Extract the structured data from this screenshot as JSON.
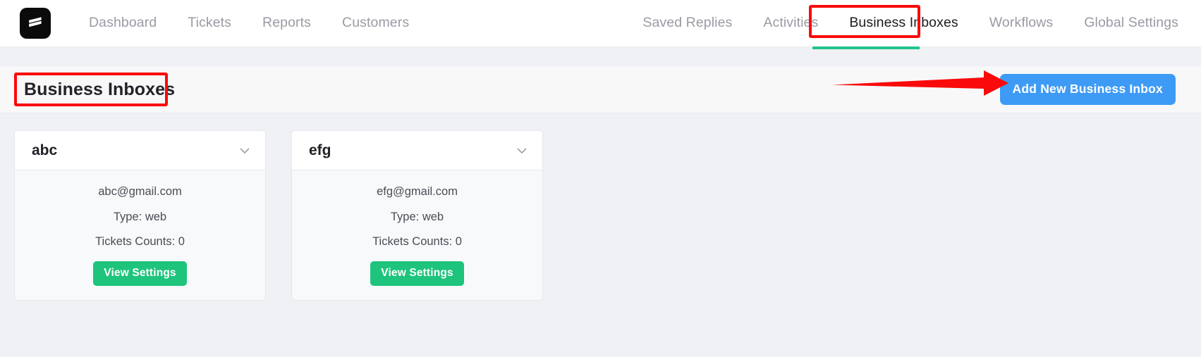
{
  "navbar": {
    "logo_icon": "brand-logo-icon",
    "left_items": [
      {
        "label": "Dashboard",
        "active": false
      },
      {
        "label": "Tickets",
        "active": false
      },
      {
        "label": "Reports",
        "active": false
      },
      {
        "label": "Customers",
        "active": false
      }
    ],
    "right_items": [
      {
        "label": "Saved Replies",
        "active": false
      },
      {
        "label": "Activities",
        "active": false
      },
      {
        "label": "Business Inboxes",
        "active": true
      },
      {
        "label": "Workflows",
        "active": false
      },
      {
        "label": "Global Settings",
        "active": false
      }
    ],
    "active_underline_color": "#23c48a"
  },
  "header": {
    "title": "Business Inboxes",
    "add_button_label": "Add New Business Inbox",
    "add_button_color": "#3e9bf5"
  },
  "annotations": {
    "color": "#fa0a0a",
    "box_around_tab": "Business Inboxes",
    "box_around_title": "Business Inboxes",
    "arrow_points_to": "Add New Business Inbox"
  },
  "cards": [
    {
      "name": "abc",
      "email": "abc@gmail.com",
      "type": "Type: web",
      "tickets": "Tickets Counts: 0",
      "button_label": "View Settings",
      "chevron_icon": "chevron-down-icon"
    },
    {
      "name": "efg",
      "email": "efg@gmail.com",
      "type": "Type: web",
      "tickets": "Tickets Counts: 0",
      "button_label": "View Settings",
      "chevron_icon": "chevron-down-icon"
    }
  ],
  "colors": {
    "page_background": "#f0f1f5",
    "band_background": "#f8f8f9",
    "success": "#1ec47c",
    "nav_text": "#9a9aa4"
  }
}
